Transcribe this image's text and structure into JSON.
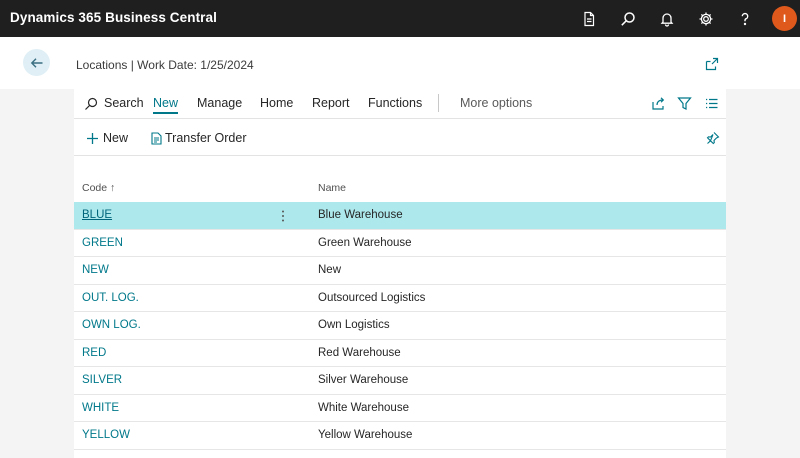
{
  "app": {
    "title": "Dynamics 365 Business Central",
    "user_initial": "I",
    "avatar_color": "#e0591c"
  },
  "topbar_icons": [
    "document-icon",
    "search-icon",
    "bell-icon",
    "gear-icon",
    "help-icon"
  ],
  "page": {
    "title": "Locations | Work Date: 1/25/2024"
  },
  "actionbar": {
    "search_label": "Search",
    "tabs": [
      "New",
      "Manage",
      "Home",
      "Report",
      "Functions"
    ],
    "active_tab": "New",
    "more_options": "More options"
  },
  "subbar": {
    "new_label": "New",
    "transfer_order_label": "Transfer Order"
  },
  "table": {
    "columns": {
      "code": "Code ↑",
      "name": "Name"
    },
    "rows": [
      {
        "code": "BLUE",
        "name": "Blue Warehouse"
      },
      {
        "code": "GREEN",
        "name": "Green Warehouse"
      },
      {
        "code": "NEW",
        "name": "New"
      },
      {
        "code": "OUT. LOG.",
        "name": "Outsourced Logistics"
      },
      {
        "code": "OWN LOG.",
        "name": "Own Logistics"
      },
      {
        "code": "RED",
        "name": "Red Warehouse"
      },
      {
        "code": "SILVER",
        "name": "Silver Warehouse"
      },
      {
        "code": "WHITE",
        "name": "White Warehouse"
      },
      {
        "code": "YELLOW",
        "name": "Yellow Warehouse"
      }
    ],
    "selected_row": 0
  },
  "colors": {
    "accent": "#00788a",
    "selected_row": "#ade8ec",
    "topbar": "#1f1f1f"
  }
}
